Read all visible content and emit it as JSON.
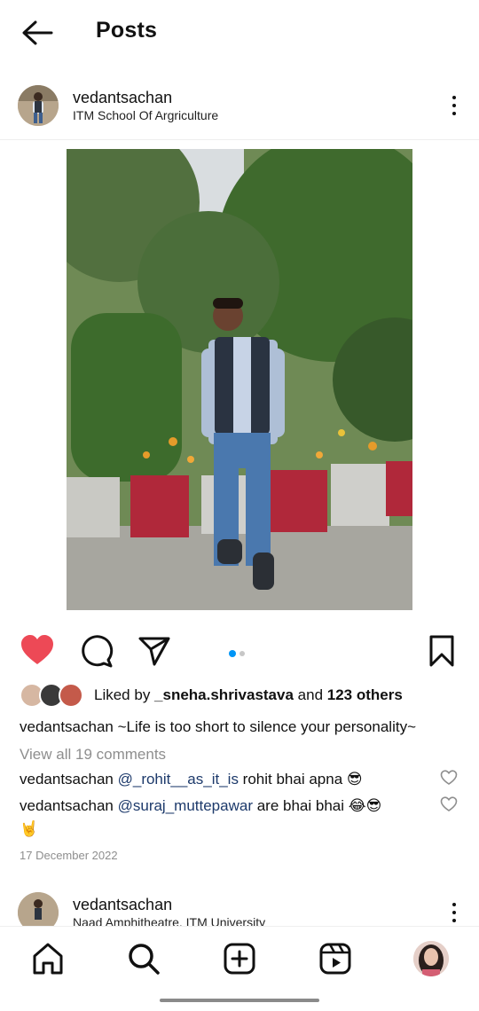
{
  "header": {
    "title": "Posts"
  },
  "post": {
    "username": "vedantsachan",
    "location": "ITM School Of Argriculture",
    "likes": {
      "prefix": "Liked by ",
      "liker": "_sneha.shrivastava",
      "and": " and ",
      "others": "123 others"
    },
    "caption": {
      "username": "vedantsachan",
      "text": " ~Life is too short to silence your personality~"
    },
    "view_comments": "View all 19 comments",
    "comments": [
      {
        "username": "vedantsachan",
        "mention": "@_rohit__as_it_is",
        "text": " rohit bhai apna 😎"
      },
      {
        "username": "vedantsachan",
        "mention": "@suraj_muttepawar",
        "text": " are bhai bhai 😂😎",
        "continuation": "🤘"
      }
    ],
    "date": "17 December 2022",
    "carousel": {
      "count": 2,
      "active": 0
    }
  },
  "next_post": {
    "username": "vedantsachan",
    "location": "Naad Amphitheatre, ITM University"
  },
  "colors": {
    "like_red": "#ed4956",
    "carousel_active": "#0095f6",
    "carousel_inactive": "#c7c7c7"
  },
  "icons": {
    "back": "arrow-left-icon",
    "more": "more-vertical-icon",
    "like": "heart-filled-icon",
    "comment": "comment-icon",
    "share": "paper-plane-icon",
    "save": "bookmark-icon",
    "home": "home-icon",
    "search": "search-icon",
    "create": "plus-square-icon",
    "reels": "reels-icon",
    "profile": "profile-avatar"
  }
}
